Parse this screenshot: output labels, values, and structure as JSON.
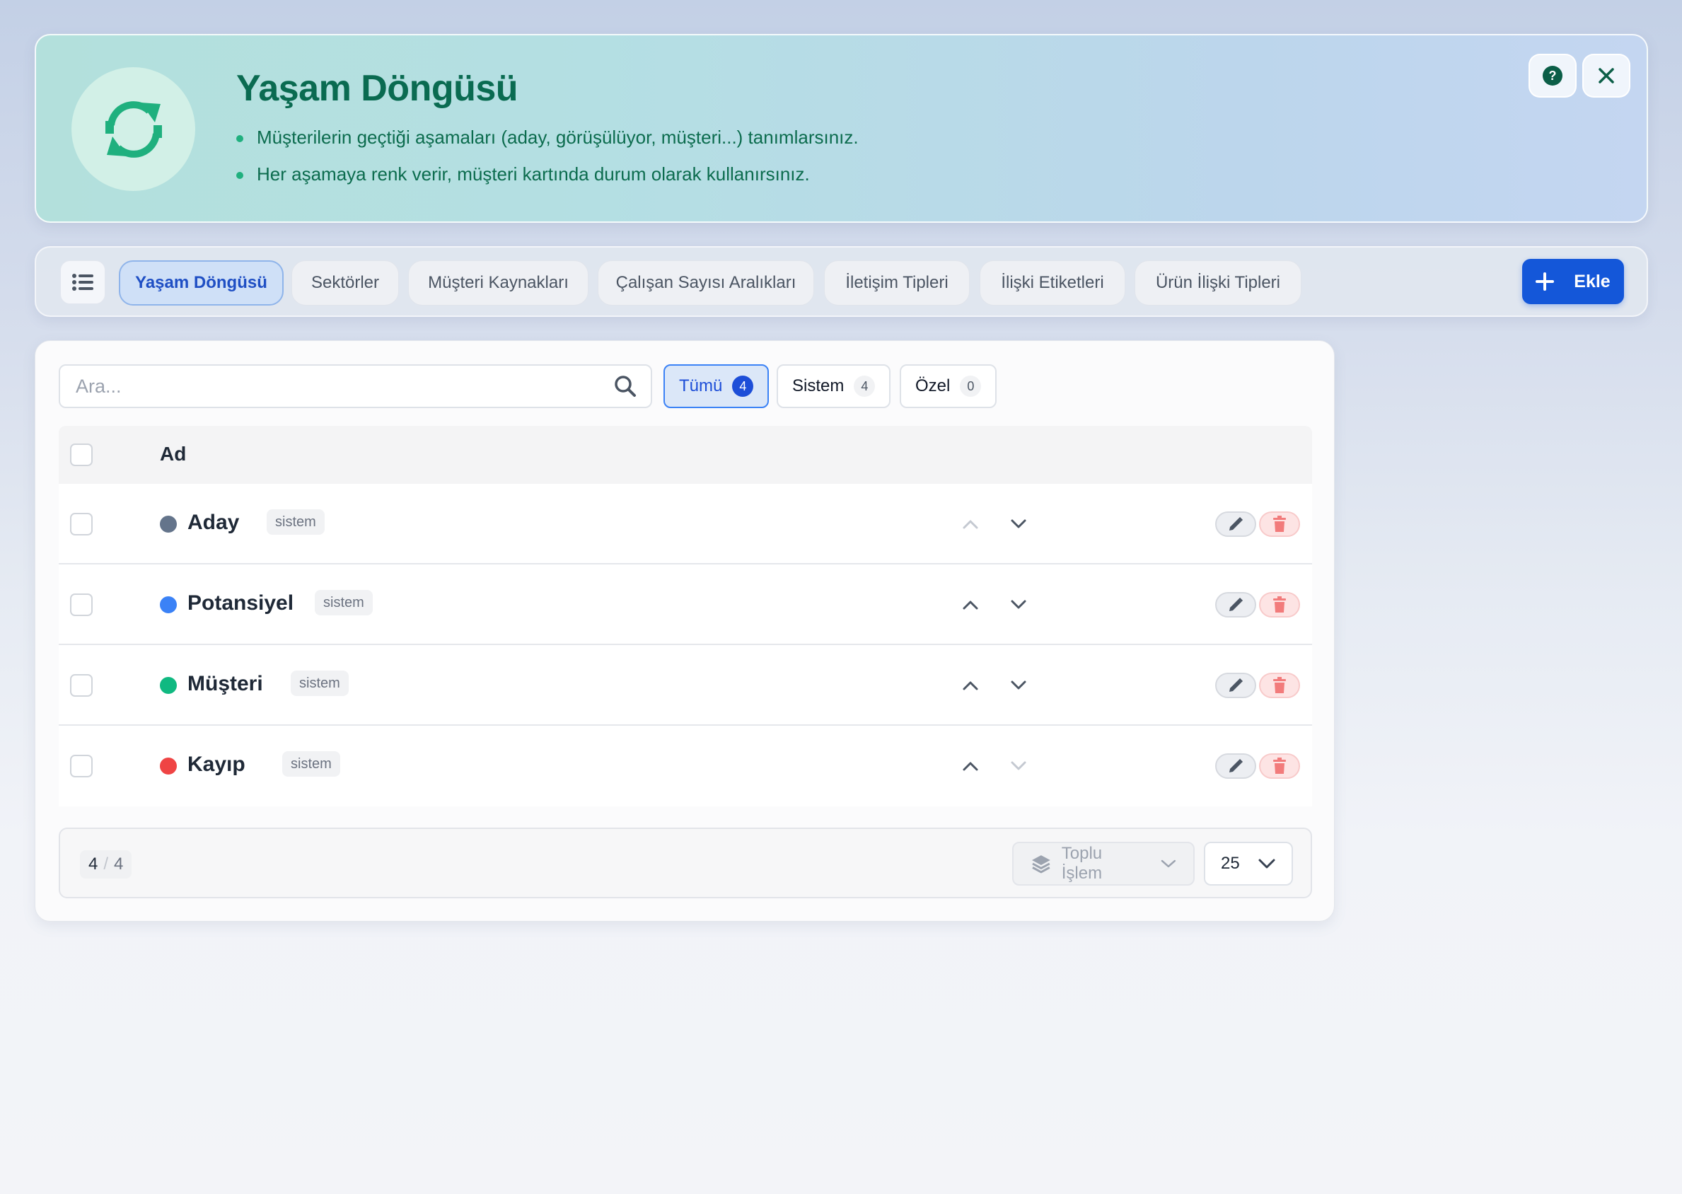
{
  "hero": {
    "title": "Yaşam Döngüsü",
    "bullets": [
      "Müşterilerin geçtiği aşamaları (aday, görüşülüyor, müşteri...) tanımlarsınız.",
      "Her aşamaya renk verir, müşteri kartında durum olarak kullanırsınız."
    ],
    "icon": "refresh-cycle-icon",
    "actions": {
      "help_icon": "question-circle-icon",
      "close_icon": "close-icon"
    }
  },
  "tabs": [
    {
      "label": "Yaşam Döngüsü",
      "active": true
    },
    {
      "label": "Sektörler",
      "active": false
    },
    {
      "label": "Müşteri Kaynakları",
      "active": false
    },
    {
      "label": "Çalışan Sayısı Aralıkları",
      "active": false
    },
    {
      "label": "İletişim Tipleri",
      "active": false
    },
    {
      "label": "İlişki Etiketleri",
      "active": false
    },
    {
      "label": "Ürün İlişki Tipleri",
      "active": false
    }
  ],
  "add_button": {
    "label": "Ekle"
  },
  "search": {
    "placeholder": "Ara...",
    "value": ""
  },
  "filters": [
    {
      "label": "Tümü",
      "count": "4",
      "active": true
    },
    {
      "label": "Sistem",
      "count": "4",
      "active": false
    },
    {
      "label": "Özel",
      "count": "0",
      "active": false
    }
  ],
  "table": {
    "header": {
      "name": "Ad"
    },
    "rows": [
      {
        "name": "Aday",
        "tag": "sistem",
        "color": "#64748b",
        "can_move_up": false,
        "can_move_down": true
      },
      {
        "name": "Potansiyel",
        "tag": "sistem",
        "color": "#3b82f6",
        "can_move_up": true,
        "can_move_down": true
      },
      {
        "name": "Müşteri",
        "tag": "sistem",
        "color": "#10b981",
        "can_move_up": true,
        "can_move_down": true
      },
      {
        "name": "Kayıp",
        "tag": "sistem",
        "color": "#ef4444",
        "can_move_up": true,
        "can_move_down": false
      }
    ]
  },
  "footer": {
    "shown": "4",
    "separator": "/",
    "total": "4",
    "bulk_action_label": "Toplu İşlem",
    "per_page": "25"
  },
  "colors": {
    "primary": "#1457d9",
    "hero_text": "#0a6b51",
    "accent_green": "#20b07e"
  }
}
